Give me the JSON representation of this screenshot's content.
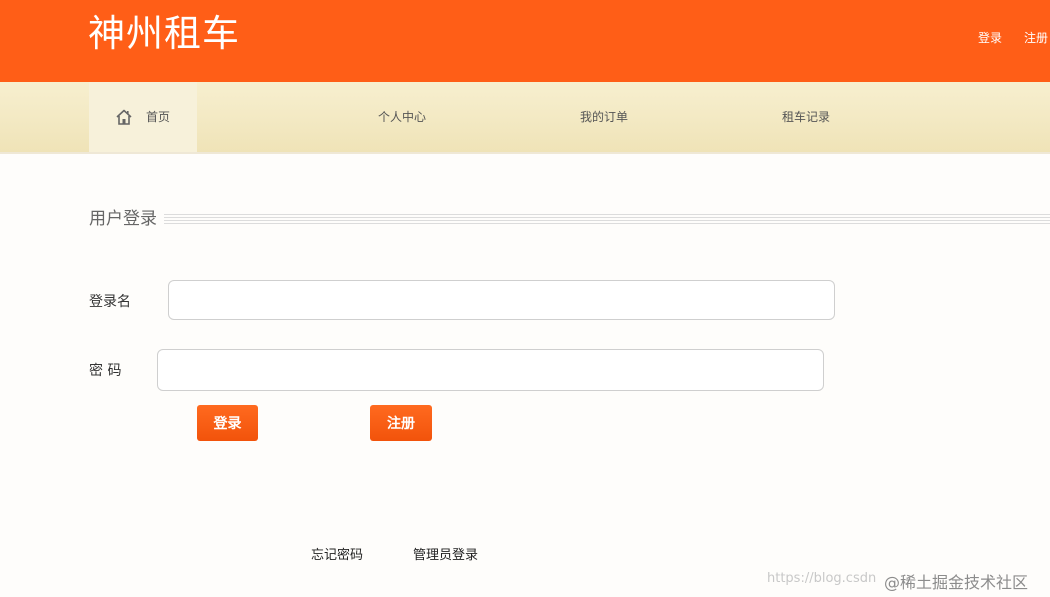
{
  "header": {
    "brand": "神州租车",
    "links": {
      "login": "登录",
      "register": "注册"
    }
  },
  "nav": {
    "home": {
      "label": "首页",
      "icon": "home-icon"
    },
    "items": [
      {
        "label": "个人中心"
      },
      {
        "label": "我的订单"
      },
      {
        "label": "租车记录"
      }
    ]
  },
  "form": {
    "title": "用户登录",
    "username_label": "登录名",
    "username_value": "",
    "password_label": "密 码",
    "password_value": "",
    "login_button": "登录",
    "register_button": "注册"
  },
  "footer_links": {
    "forgot_password": "忘记密码",
    "admin_login": "管理员登录"
  },
  "watermark": {
    "url": "https://blog.csdn",
    "site": "@稀土掘金技术社区"
  },
  "colors": {
    "brand_orange": "#ff5e17",
    "nav_bg": "#f3e9c3",
    "button": "#f2530b"
  }
}
